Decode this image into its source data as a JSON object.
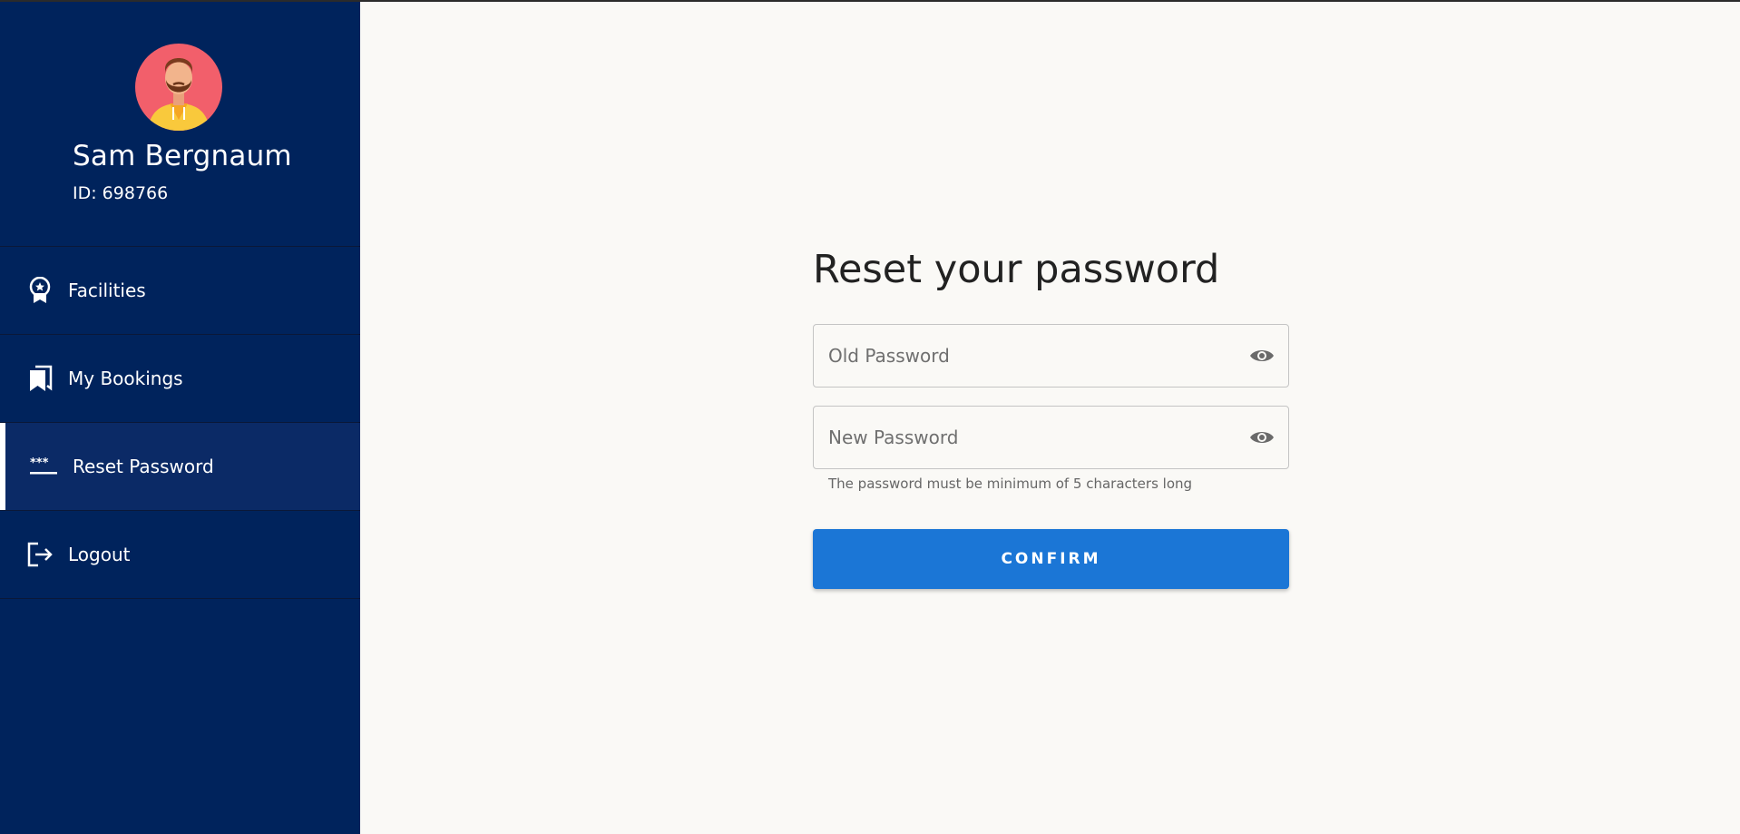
{
  "user": {
    "name": "Sam Bergnaum",
    "id_text": "ID: 698766",
    "avatar_icon": "bearded-man-avatar"
  },
  "sidebar": {
    "items": [
      {
        "label": "Facilities",
        "icon": "award-badge-icon",
        "active": false
      },
      {
        "label": "My Bookings",
        "icon": "bookmarks-icon",
        "active": false
      },
      {
        "label": "Reset Password",
        "icon": "password-dots-icon",
        "active": true
      },
      {
        "label": "Logout",
        "icon": "logout-icon",
        "active": false
      }
    ]
  },
  "form": {
    "title": "Reset your password",
    "old_password": {
      "placeholder": "Old Password",
      "value": ""
    },
    "new_password": {
      "placeholder": "New Password",
      "value": ""
    },
    "helper_text": "The password must be minimum of 5 characters long",
    "confirm_label": "CONFIRM"
  },
  "colors": {
    "sidebar_bg": "#00235c",
    "sidebar_active_bg": "#0b2a66",
    "page_bg": "#faf9f6",
    "primary_button": "#1b76d6"
  }
}
